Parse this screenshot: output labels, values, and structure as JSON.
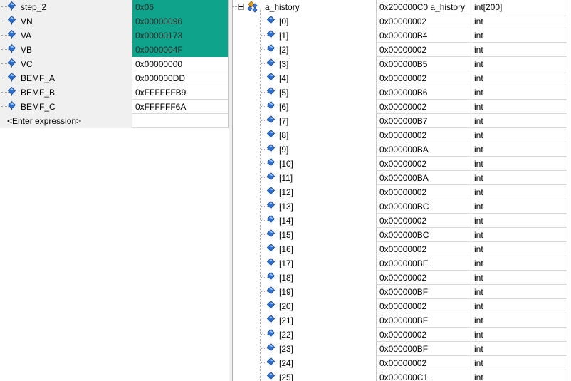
{
  "left_watch": {
    "rows": [
      {
        "name": "step_2",
        "value": "0x06",
        "changed": true
      },
      {
        "name": "VN",
        "value": "0x00000096",
        "changed": true
      },
      {
        "name": "VA",
        "value": "0x00000173",
        "changed": true
      },
      {
        "name": "VB",
        "value": "0x0000004F",
        "changed": true
      },
      {
        "name": "VC",
        "value": "0x00000000",
        "changed": false
      },
      {
        "name": "BEMF_A",
        "value": "0x000000DD",
        "changed": false
      },
      {
        "name": "BEMF_B",
        "value": "0xFFFFFFB9",
        "changed": false
      },
      {
        "name": "BEMF_C",
        "value": "0xFFFFFF6A",
        "changed": false
      }
    ],
    "enter_expression": "<Enter expression>"
  },
  "right_watch": {
    "root": {
      "name": "a_history",
      "value": "0x200000C0 a_history",
      "type": "int[200]",
      "expanded": true
    },
    "elements": [
      {
        "index": "[0]",
        "value": "0x00000002",
        "type": "int"
      },
      {
        "index": "[1]",
        "value": "0x000000B4",
        "type": "int"
      },
      {
        "index": "[2]",
        "value": "0x00000002",
        "type": "int"
      },
      {
        "index": "[3]",
        "value": "0x000000B5",
        "type": "int"
      },
      {
        "index": "[4]",
        "value": "0x00000002",
        "type": "int"
      },
      {
        "index": "[5]",
        "value": "0x000000B6",
        "type": "int"
      },
      {
        "index": "[6]",
        "value": "0x00000002",
        "type": "int"
      },
      {
        "index": "[7]",
        "value": "0x000000B7",
        "type": "int"
      },
      {
        "index": "[8]",
        "value": "0x00000002",
        "type": "int"
      },
      {
        "index": "[9]",
        "value": "0x000000BA",
        "type": "int"
      },
      {
        "index": "[10]",
        "value": "0x00000002",
        "type": "int"
      },
      {
        "index": "[11]",
        "value": "0x000000BA",
        "type": "int"
      },
      {
        "index": "[12]",
        "value": "0x00000002",
        "type": "int"
      },
      {
        "index": "[13]",
        "value": "0x000000BC",
        "type": "int"
      },
      {
        "index": "[14]",
        "value": "0x00000002",
        "type": "int"
      },
      {
        "index": "[15]",
        "value": "0x000000BC",
        "type": "int"
      },
      {
        "index": "[16]",
        "value": "0x00000002",
        "type": "int"
      },
      {
        "index": "[17]",
        "value": "0x000000BE",
        "type": "int"
      },
      {
        "index": "[18]",
        "value": "0x00000002",
        "type": "int"
      },
      {
        "index": "[19]",
        "value": "0x000000BF",
        "type": "int"
      },
      {
        "index": "[20]",
        "value": "0x00000002",
        "type": "int"
      },
      {
        "index": "[21]",
        "value": "0x000000BF",
        "type": "int"
      },
      {
        "index": "[22]",
        "value": "0x00000002",
        "type": "int"
      },
      {
        "index": "[23]",
        "value": "0x000000BF",
        "type": "int"
      },
      {
        "index": "[24]",
        "value": "0x00000002",
        "type": "int"
      },
      {
        "index": "[25]",
        "value": "0x000000C1",
        "type": "int"
      }
    ]
  },
  "icons": {
    "variable": "variable-diamond-icon",
    "structure": "array-structure-icon",
    "expander": "collapse-minus-icon"
  },
  "colors": {
    "changed_value_bg": "#0fa38b",
    "name_column_bg": "#f0f0f0",
    "grid_line": "#c9c9c9",
    "variable_icon": "#2f6fd0"
  }
}
